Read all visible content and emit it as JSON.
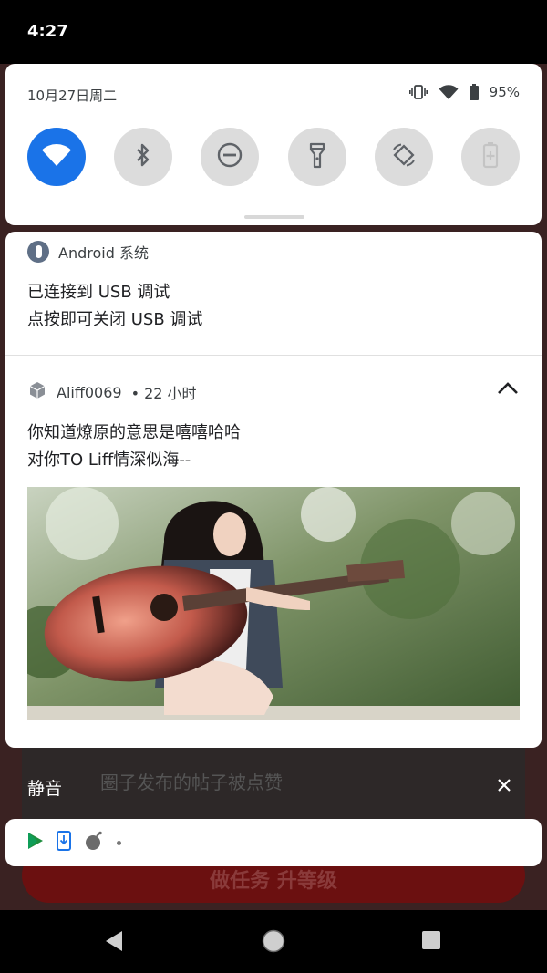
{
  "status_bar": {
    "time": "4:27"
  },
  "quick_settings": {
    "date": "10月27日周二",
    "battery": "95%",
    "tiles": [
      "wifi-icon",
      "bluetooth-icon",
      "do-not-disturb-icon",
      "flashlight-icon",
      "auto-rotate-icon",
      "battery-saver-icon"
    ],
    "active_color": "#1a73e8"
  },
  "notif_usb": {
    "app": "Android 系统",
    "title": "已连接到 USB 调试",
    "text": "点按即可关闭 USB 调试"
  },
  "notif_aliff": {
    "app": "Aliff0069",
    "time": "• 22 小时",
    "line1": "你知道燎原的意思是嘻嘻哈哈",
    "line2": "对你TO Liff情深似海--"
  },
  "silent": {
    "label": "静音",
    "icons": [
      "play-store-icon",
      "download-icon",
      "bomb-icon"
    ]
  },
  "background_app": {
    "title": "圈子发布的帖子被点赞",
    "button": "做任务 升等级"
  }
}
